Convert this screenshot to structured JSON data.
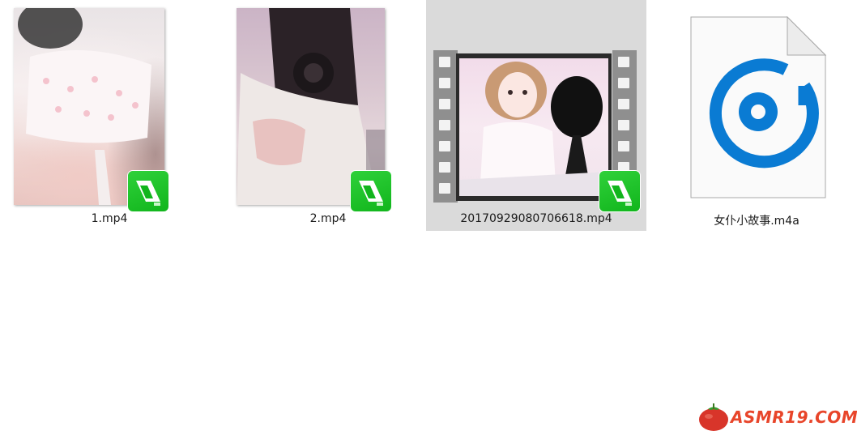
{
  "files": [
    {
      "name": "1.mp4",
      "type": "video"
    },
    {
      "name": "2.mp4",
      "type": "video"
    },
    {
      "name": "20170929080706618.mp4",
      "type": "video",
      "selected": true
    },
    {
      "name": "女仆小故事.m4a",
      "type": "audio"
    }
  ],
  "watermark": {
    "text": "ASMR19.COM"
  },
  "colors": {
    "selection": "#dadada",
    "video_badge": "#11b51c",
    "audio_icon": "#0a7bd3",
    "watermark": "#e8452a"
  }
}
